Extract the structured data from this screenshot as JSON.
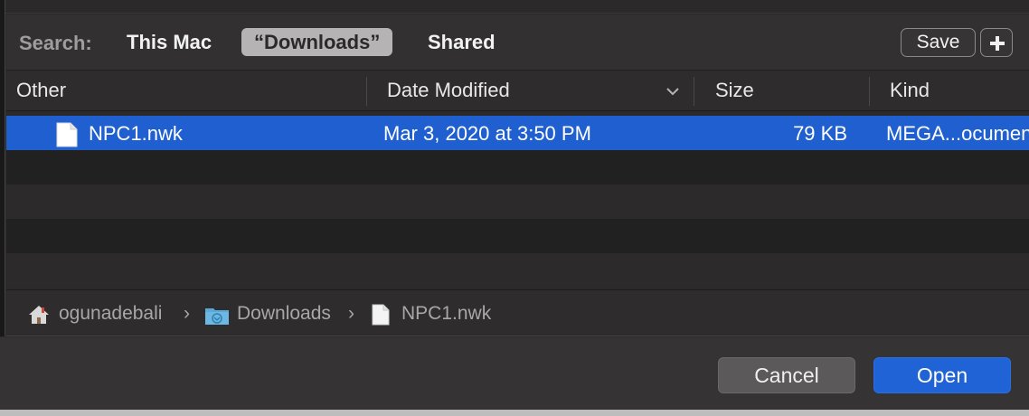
{
  "search": {
    "label": "Search:",
    "scopes": [
      "This Mac",
      "“Downloads”",
      "Shared"
    ],
    "selected_scope": "“Downloads”",
    "save_label": "Save"
  },
  "columns": {
    "name": "Other",
    "date": "Date Modified",
    "size": "Size",
    "kind": "Kind",
    "sorted_by": "Date Modified"
  },
  "files": [
    {
      "name": "NPC1.nwk",
      "date": "Mar 3, 2020 at 3:50 PM",
      "size": "79 KB",
      "kind": "MEGA...ocument",
      "selected": true
    }
  ],
  "path": {
    "items": [
      "ogunadebali",
      "Downloads",
      "NPC1.nwk"
    ],
    "icons": [
      "home-icon",
      "downloads-folder-icon",
      "document-icon"
    ]
  },
  "buttons": {
    "cancel": "Cancel",
    "open": "Open"
  },
  "colors": {
    "selection": "#1f5fcf",
    "open_button": "#1f63d6",
    "scope_highlight": "#b5b3b3",
    "folder": "#5aa9d6"
  }
}
